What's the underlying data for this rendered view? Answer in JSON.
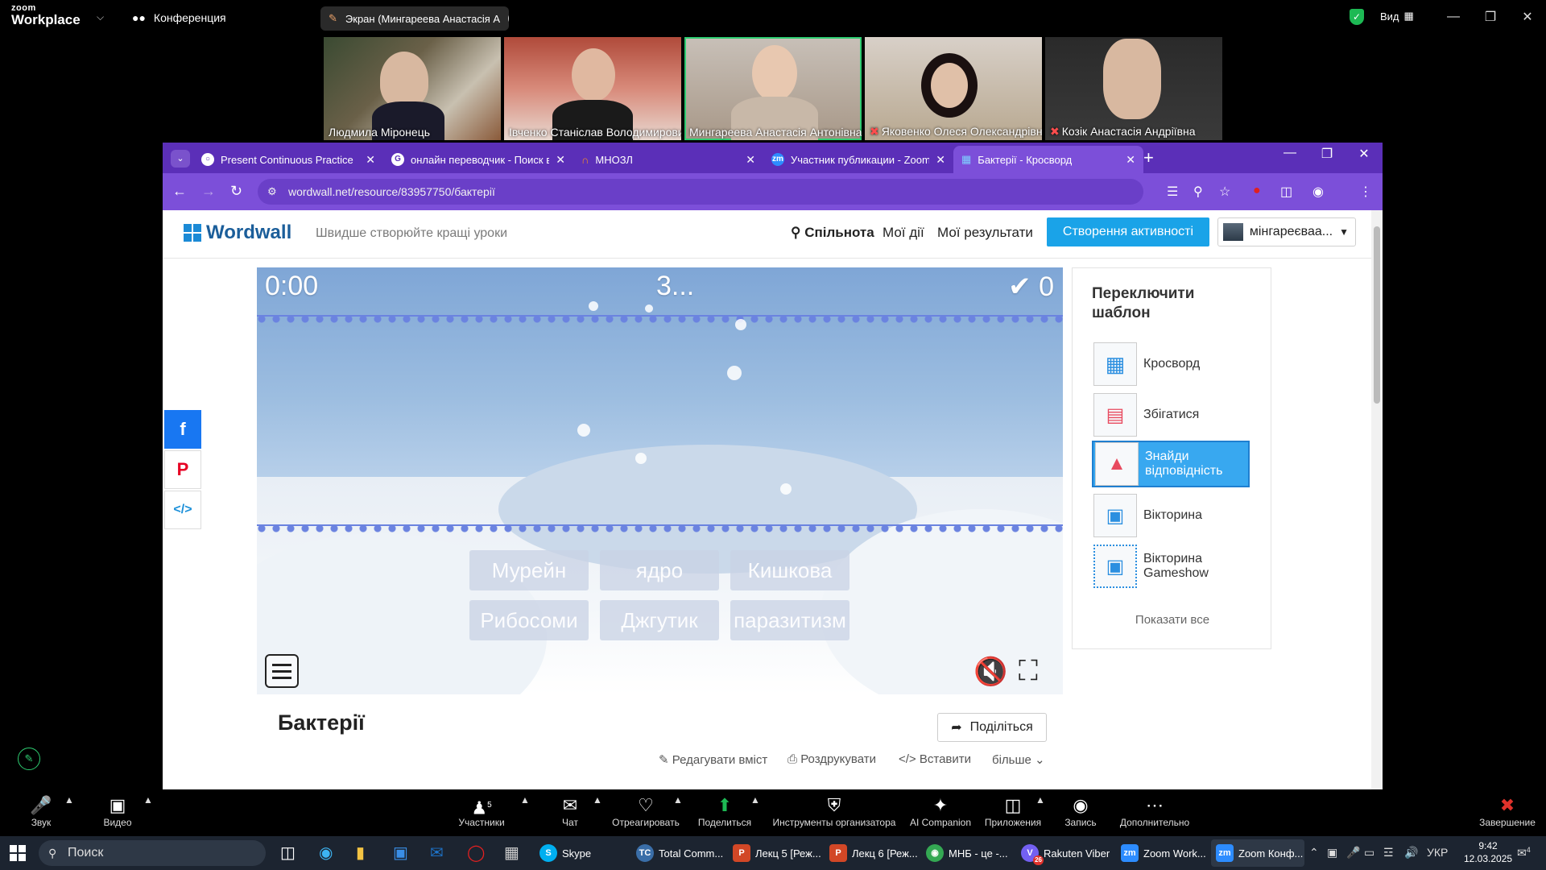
{
  "zoom": {
    "logo_line1": "zoom",
    "logo_line2": "Workplace",
    "meeting_label": "Конференция",
    "share_label": "Экран (Мингареева Анастасія А",
    "view_label": "Вид"
  },
  "participants": [
    {
      "name": "Людмила Міронець",
      "muted": false
    },
    {
      "name": "Івченко Станіслав Володимирович",
      "muted": false
    },
    {
      "name": "Мингареева Анастасія Антонівна",
      "muted": false
    },
    {
      "name": "Яковенко Олеся Олександрівна",
      "muted": true
    },
    {
      "name": "Козік Анастасія Андріївна",
      "muted": true
    }
  ],
  "browser": {
    "tabs": [
      {
        "title": "Present Continuous Practice"
      },
      {
        "title": "онлайн переводчик - Поиск в"
      },
      {
        "title": "МНОЗЛ"
      },
      {
        "title": "Участник публикации - Zoom"
      },
      {
        "title": "Бактерії - Кросворд"
      }
    ],
    "url": "wordwall.net/resource/83957750/бактерії"
  },
  "wordwall": {
    "logo": "Wordwall",
    "tagline": "Швидше створюйте кращі уроки",
    "nav": [
      "Спільнота",
      "Мої дії",
      "Мої результати"
    ],
    "create_button": "Створення активності",
    "user": "мінгареєваа..."
  },
  "game": {
    "timer": "0:00",
    "countdown": "3...",
    "score": "0",
    "cards": [
      "Мурейн",
      "ядро",
      "Кишкова",
      "Рибосоми",
      "Джгутик",
      "паразитизм"
    ]
  },
  "page": {
    "title": "Бактерії",
    "share_button": "Поділіться",
    "actions": [
      "Редагувати вміст",
      "Роздрукувати",
      "Вставити",
      "більше"
    ]
  },
  "panel": {
    "title_line1": "Переключити",
    "title_line2": "шаблон",
    "templates": [
      {
        "label": "Кросворд",
        "selected": false
      },
      {
        "label": "Збігатися",
        "selected": false
      },
      {
        "label": "Знайди відповідність",
        "selected": true
      },
      {
        "label": "Вікторина",
        "selected": false
      },
      {
        "label": "Вікторина Gameshow",
        "selected": false
      }
    ],
    "show_all": "Показати все"
  },
  "toolbar": {
    "audio": "Звук",
    "video": "Видео",
    "participants": "Участники",
    "participants_count": "5",
    "chat": "Чат",
    "react": "Отреагировать",
    "share": "Поделиться",
    "host_tools": "Инструменты организатора",
    "ai": "AI Companion",
    "apps": "Приложения",
    "record": "Запись",
    "more": "Дополнительно",
    "end": "Завершение"
  },
  "taskbar": {
    "search": "Поиск",
    "apps": [
      {
        "label": "Skype"
      },
      {
        "label": "Total Comm..."
      },
      {
        "label": "Лекц 5 [Реж..."
      },
      {
        "label": "Лекц 6 [Реж..."
      },
      {
        "label": "МНБ - це -..."
      },
      {
        "label": "Rakuten Viber"
      },
      {
        "label": "Zoom Work..."
      },
      {
        "label": "Zoom Конф..."
      }
    ],
    "lang": "УКР",
    "time": "9:42",
    "date": "12.03.2025",
    "notif_count": "4",
    "viber_badge": "26"
  }
}
